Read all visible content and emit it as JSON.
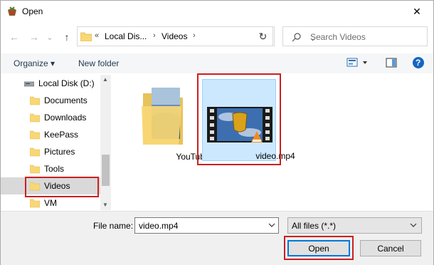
{
  "window": {
    "title": "Open",
    "close_glyph": "✕"
  },
  "nav": {
    "back_glyph": "←",
    "forward_glyph": "→",
    "dropdown_glyph": "⌄",
    "up_glyph": "↑",
    "prefix": "«",
    "breadcrumbs": [
      "Local Dis...",
      "Videos"
    ],
    "separator": "›",
    "refresh_glyph": "↻"
  },
  "search": {
    "placeholder": "Search Videos"
  },
  "toolbar": {
    "organize": "Organize ▾",
    "new_folder": "New folder",
    "help_glyph": "?"
  },
  "sidebar": {
    "drive": "Local Disk (D:)",
    "folders": [
      "Documents",
      "Downloads",
      "KeePass",
      "Pictures",
      "Tools",
      "Videos",
      "VM"
    ],
    "selected": "Videos"
  },
  "files": [
    {
      "name": "YouTube",
      "type": "folder"
    },
    {
      "name": "video.mp4",
      "type": "video"
    }
  ],
  "bottom": {
    "file_name_label": "File name:",
    "file_name_value": "video.mp4",
    "filter_value": "All files (*.*)",
    "open_label": "Open",
    "cancel_label": "Cancel"
  },
  "colors": {
    "accent": "#0078d7",
    "highlight": "#cc1f1f",
    "selection": "#cce8ff",
    "folder": "#f8d775"
  }
}
